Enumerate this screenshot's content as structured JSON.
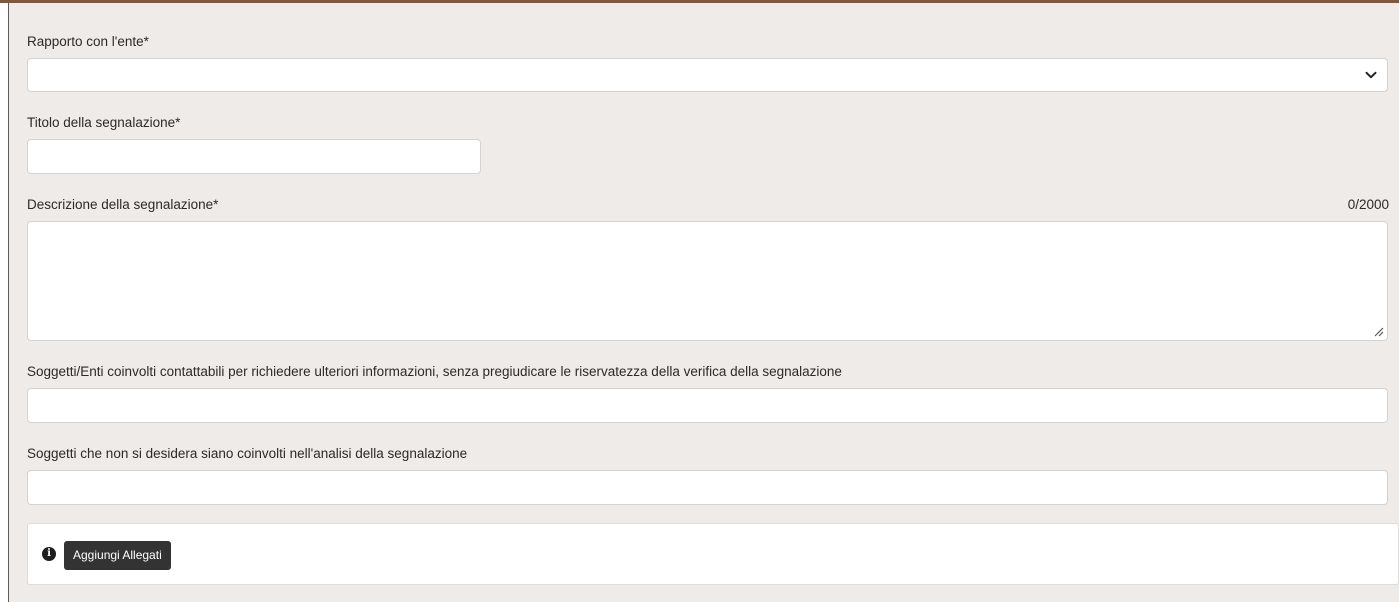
{
  "form": {
    "rapporto": {
      "label": "Rapporto con l'ente*",
      "value": ""
    },
    "titolo": {
      "label": "Titolo della segnalazione*",
      "value": ""
    },
    "descrizione": {
      "label": "Descrizione della segnalazione*",
      "counter": "0/2000",
      "value": ""
    },
    "soggetti_coinvolti": {
      "label": "Soggetti/Enti coinvolti contattabili per richiedere ulteriori informazioni, senza pregiudicare le riservatezza della verifica della segnalazione",
      "value": ""
    },
    "soggetti_esclusi": {
      "label": "Soggetti che non si desidera siano coinvolti nell'analisi della segnalazione",
      "value": ""
    },
    "allegati": {
      "button_label": "Aggiungi Allegati",
      "info_icon": "info-circle-icon"
    }
  },
  "colors": {
    "panel_bg": "#efebe8",
    "top_border": "#7a5a44",
    "button_bg": "#333333"
  }
}
